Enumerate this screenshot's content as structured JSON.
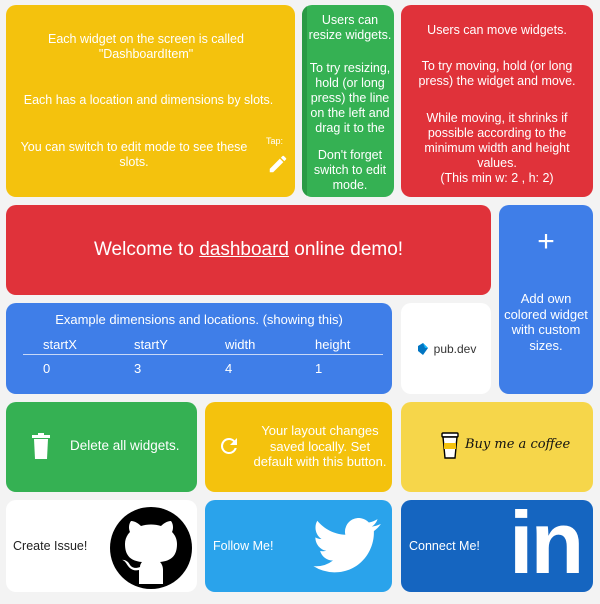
{
  "intro": {
    "lines": [
      "Each widget on the screen is called \"DashboardItem\"",
      "Each has a location and dimensions by slots.",
      "You can switch to edit mode to see these slots."
    ],
    "tap_label": "Tap:"
  },
  "resize": {
    "lines": [
      "Users can resize widgets.",
      "To try resizing, hold (or long press) the line on the left and drag it to the",
      "Don't forget switch to edit mode."
    ]
  },
  "move": {
    "lines": [
      "Users can move widgets.",
      "To try moving, hold (or long press) the widget and move.",
      "While moving, it shrinks if possible according to the minimum width and height values.",
      "(This min w: 2 , h: 2)"
    ]
  },
  "welcome": {
    "prefix": "Welcome to ",
    "link": "dashboard",
    "suffix": " online demo!"
  },
  "add_widget": {
    "plus": "+",
    "label": "Add own colored widget with custom sizes."
  },
  "dimensions": {
    "title": "Example dimensions and locations. (showing this)",
    "headers": [
      "startX",
      "startY",
      "width",
      "height"
    ],
    "values": [
      "0",
      "3",
      "4",
      "1"
    ]
  },
  "pubdev": {
    "label": "pub.dev"
  },
  "delete": {
    "label": "Delete all widgets."
  },
  "layout": {
    "label": "Your layout changes saved locally. Set default with this button."
  },
  "coffee": {
    "label": "Buy me a coffee"
  },
  "issue": {
    "label": "Create Issue!"
  },
  "follow": {
    "label": "Follow Me!"
  },
  "connect": {
    "label": "Connect Me!",
    "logo_text": "in"
  },
  "colors": {
    "yellow": "#f4c20d",
    "red": "#e0323a",
    "green": "#35b153",
    "blue": "#3f7ee8",
    "twitter": "#2aa3eb",
    "linkedin": "#1565c0"
  }
}
